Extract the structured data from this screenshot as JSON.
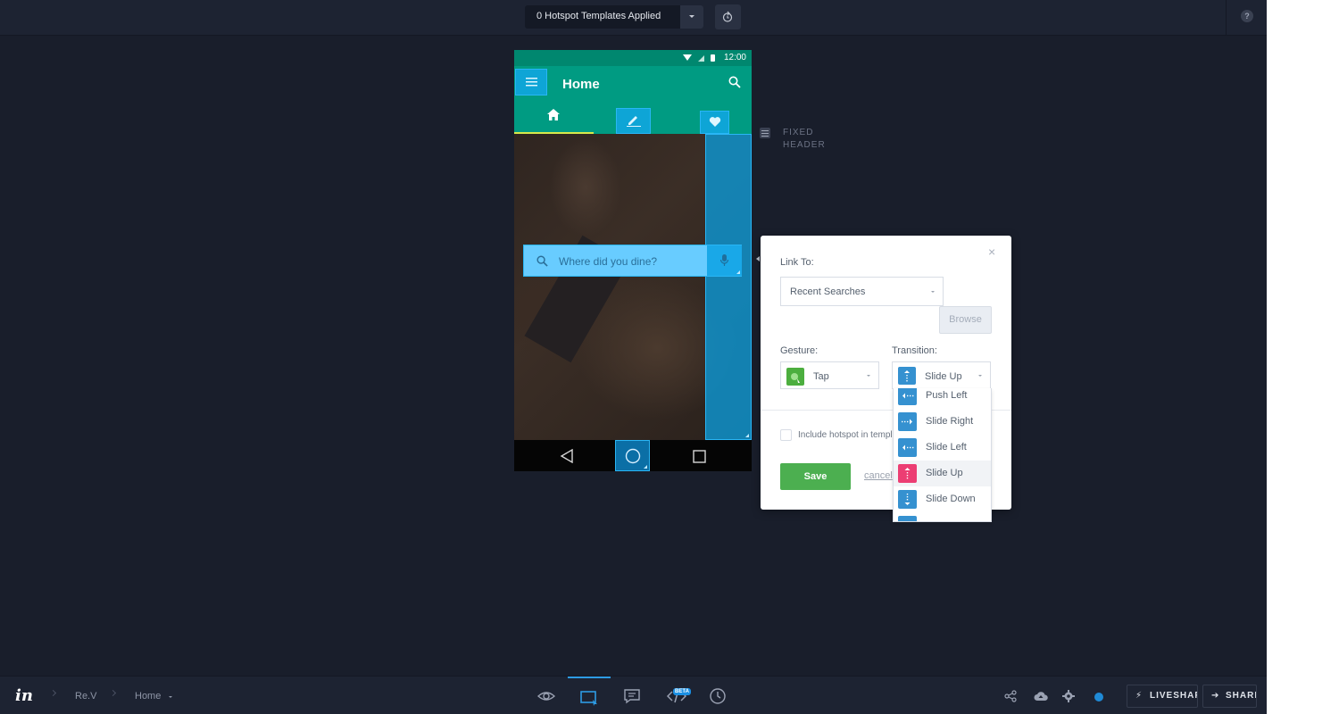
{
  "topbar": {
    "template_label": "0 Hotspot Templates Applied",
    "help_label": "?"
  },
  "phone": {
    "status_time": "12:00",
    "app_title": "Home",
    "search_placeholder": "Where did you dine?"
  },
  "fixed_header": {
    "label": "FIXED HEADER"
  },
  "dialog": {
    "link_to_label": "Link To:",
    "link_to_value": "Recent Searches",
    "browse_label": "Browse",
    "gesture_label": "Gesture:",
    "gesture_value": "Tap",
    "transition_label": "Transition:",
    "transition_value": "Slide Up",
    "include_label": "Include hotspot in template",
    "save_label": "Save",
    "cancel_label": "cancel",
    "close_glyph": "×"
  },
  "transition_menu": {
    "items": [
      {
        "label": "Push Left",
        "icon": "arrow-left-icon"
      },
      {
        "label": "Slide Right",
        "icon": "arrow-right-icon"
      },
      {
        "label": "Slide Left",
        "icon": "arrow-left-icon"
      },
      {
        "label": "Slide Up",
        "icon": "arrow-up-icon",
        "selected": true
      },
      {
        "label": "Slide Down",
        "icon": "arrow-down-icon"
      }
    ]
  },
  "bottombar": {
    "logo": "in",
    "breadcrumb": [
      "Re.V",
      "Home"
    ],
    "beta_badge": "BETA",
    "liveshare_label": "LIVESHARE",
    "share_label": "SHARE"
  },
  "colors": {
    "accent_blue": "#2d9be3",
    "save_green": "#4caf50",
    "selected_pink": "#ec3e73",
    "hotspot_blue": "#0ea5d6",
    "app_teal": "#009b82"
  }
}
